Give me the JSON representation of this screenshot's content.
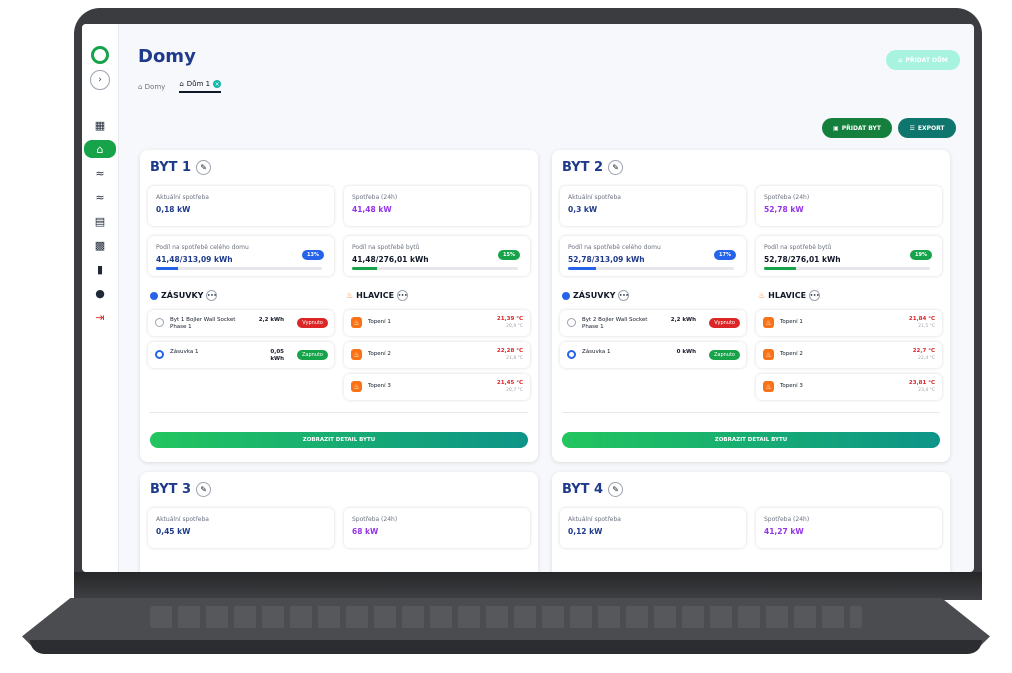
{
  "app": {
    "title": "Domy"
  },
  "sidebar": {
    "items": [
      {
        "icon": "dashboard-icon"
      },
      {
        "icon": "home-icon",
        "active": true
      },
      {
        "icon": "graph-icon"
      },
      {
        "icon": "graph-alt-icon"
      },
      {
        "icon": "device-icon"
      },
      {
        "icon": "grid-icon"
      },
      {
        "icon": "document-icon"
      },
      {
        "icon": "user-icon"
      },
      {
        "icon": "logout-icon"
      }
    ]
  },
  "breadcrumb": {
    "home": "Domy",
    "current": "Dům 1"
  },
  "header": {
    "add_house": "PŘIDAT DŮM",
    "add_flat": "PŘIDAT BYT",
    "export": "EXPORT"
  },
  "labels": {
    "current": "Aktuální spotřeba",
    "daily": "Spotřeba (24h)",
    "share_house": "Podíl na spotřebě celého domu",
    "share_flats": "Podíl na spotřebě bytů",
    "sockets": "ZÁSUVKY",
    "heads": "HLAVICE",
    "detail": "ZOBRAZIT DETAIL BYTU"
  },
  "flats": [
    {
      "name": "BYT 1",
      "current": "0,18 kW",
      "daily": "41,48 kW",
      "share_house": "41,48/313,09 kWh",
      "share_house_pct": "13%",
      "share_house_frac": 0.13,
      "share_flats": "41,48/276,01 kWh",
      "share_flats_pct": "15%",
      "share_flats_frac": 0.15,
      "sockets": [
        {
          "name": "Byt 1 Bojler Wall Socket Phase 1",
          "value": "2,2 kWh",
          "status": "Vypnuto",
          "on": false
        },
        {
          "name": "Zásuvka 1",
          "value": "0,05 kWh",
          "status": "Zapnuto",
          "on": true
        }
      ],
      "heaters": [
        {
          "name": "Topení 1",
          "temp": "21,39 °C",
          "target": "20,9 °C"
        },
        {
          "name": "Topení 2",
          "temp": "22,28 °C",
          "target": "21,8 °C"
        },
        {
          "name": "Topení 3",
          "temp": "21,45 °C",
          "target": "20,7 °C"
        }
      ]
    },
    {
      "name": "BYT 2",
      "current": "0,3 kW",
      "daily": "52,78 kW",
      "share_house": "52,78/313,09 kWh",
      "share_house_pct": "17%",
      "share_house_frac": 0.17,
      "share_flats": "52,78/276,01 kWh",
      "share_flats_pct": "19%",
      "share_flats_frac": 0.19,
      "sockets": [
        {
          "name": "Byt 2 Bojler Wall Socket Phase 1",
          "value": "2,2 kWh",
          "status": "Vypnuto",
          "on": false
        },
        {
          "name": "Zásuvka 1",
          "value": "0 kWh",
          "status": "Zapnuto",
          "on": true
        }
      ],
      "heaters": [
        {
          "name": "Topení 1",
          "temp": "21,84 °C",
          "target": "21,5 °C"
        },
        {
          "name": "Topení 2",
          "temp": "22,7 °C",
          "target": "22,4 °C"
        },
        {
          "name": "Topení 3",
          "temp": "23,81 °C",
          "target": "23,4 °C"
        }
      ]
    },
    {
      "name": "BYT 3",
      "current": "0,45 kW",
      "daily": "68 kW"
    },
    {
      "name": "BYT 4",
      "current": "0,12 kW",
      "daily": "41,27 kW"
    }
  ],
  "colors": {
    "accent": "#16a34a",
    "title": "#1e3a8a",
    "off": "#dc2626",
    "on": "#16a34a",
    "bar_house": "#2563eb",
    "bar_flats": "#16a34a"
  }
}
